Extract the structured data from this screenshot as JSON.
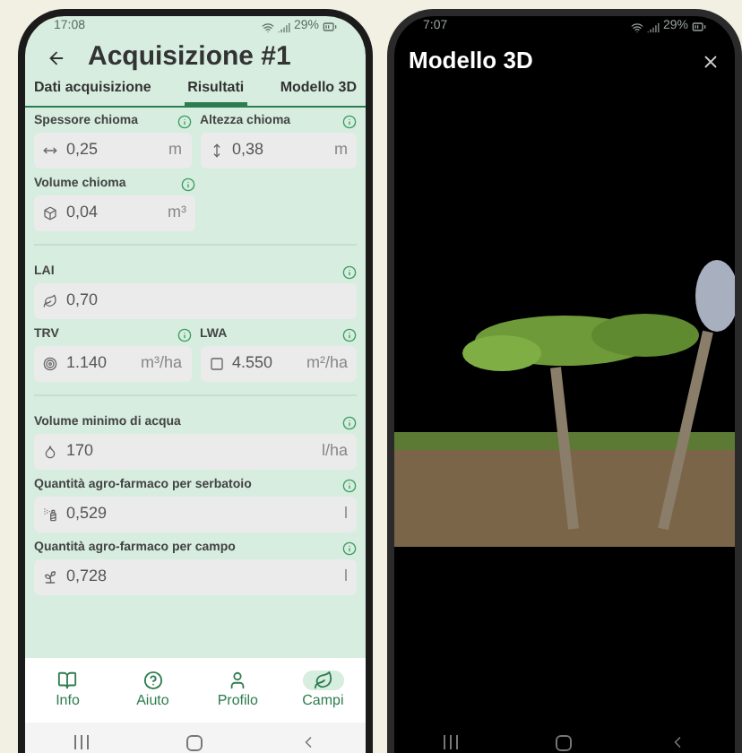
{
  "left_phone": {
    "status_bar": {
      "time": "17:08",
      "battery": "29%"
    },
    "title": "Acquisizione #1",
    "tabs": [
      {
        "label": "Dati acquisizione",
        "selected": false
      },
      {
        "label": "Risultati",
        "selected": true
      },
      {
        "label": "Modello 3D",
        "selected": false
      }
    ],
    "sections": [
      {
        "rows": [
          [
            {
              "label": "Spessore chioma",
              "value": "0,25",
              "unit": "m"
            },
            {
              "label": "Altezza chioma",
              "value": "0,38",
              "unit": "m"
            }
          ],
          [
            {
              "label": "Volume chioma",
              "value": "0,04",
              "unit": "m³"
            }
          ]
        ]
      },
      {
        "rows": [
          [
            {
              "label": "LAI",
              "value": "0,70"
            }
          ],
          [
            {
              "label": "TRV",
              "value": "1.140",
              "unit": "m³/ha"
            },
            {
              "label": "LWA",
              "value": "4.550",
              "unit": "m²/ha"
            }
          ]
        ]
      },
      {
        "rows": [
          [
            {
              "label": "Volume minimo di acqua",
              "value": "170",
              "unit": "l/ha"
            }
          ],
          [
            {
              "label": "Quantità agro-farmaco per serbatoio",
              "value": "0,529",
              "unit": "l"
            }
          ],
          [
            {
              "label": "Quantità agro-farmaco per campo",
              "value": "0,728",
              "unit": "l"
            }
          ]
        ]
      }
    ],
    "bottom_nav": [
      {
        "label": "Info",
        "selected": false
      },
      {
        "label": "Aiuto",
        "selected": false
      },
      {
        "label": "Profilo",
        "selected": false
      },
      {
        "label": "Campi",
        "selected": true
      }
    ]
  },
  "right_phone": {
    "status_bar": {
      "time": "7:07",
      "battery": "29%"
    },
    "title": "Modello 3D"
  }
}
